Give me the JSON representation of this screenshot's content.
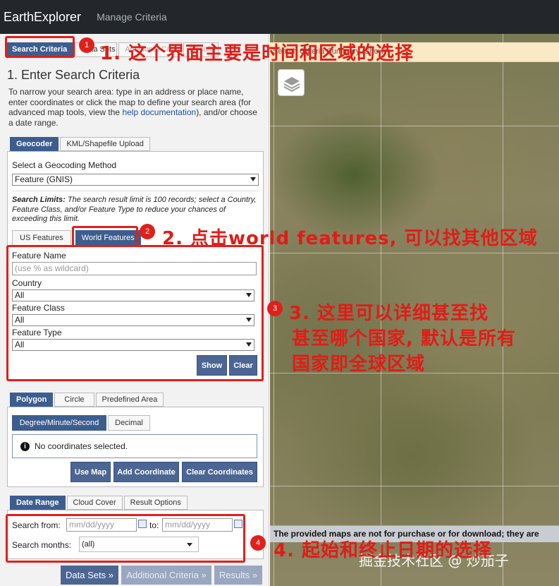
{
  "header": {
    "brand": "EarthExplorer",
    "nav_item": "Manage Criteria"
  },
  "tabs": [
    {
      "label": "Search Criteria",
      "active": true
    },
    {
      "label": "Data Sets",
      "active": false
    },
    {
      "label": "Additional Criteria",
      "active": false
    },
    {
      "label": "Results",
      "active": false
    }
  ],
  "section": {
    "title": "1. Enter Search Criteria",
    "intro_pre": "To narrow your search area: type in an address or place name, enter coordinates or click the map to define your search area (for advanced map tools, view the ",
    "intro_link": "help documentation",
    "intro_post": "), and/or choose a date range."
  },
  "geocoder": {
    "tabs": [
      "Geocoder",
      "KML/Shapefile Upload"
    ],
    "method_label": "Select a Geocoding Method",
    "method_value": "Feature (GNIS)",
    "limits_bold": "Search Limits:",
    "limits_text": " The search result limit is 100 records; select a Country, Feature Class, and/or Feature Type to reduce your chances of exceeding this limit.",
    "feature_tabs": [
      "US Features",
      "World Features"
    ],
    "feature_name_label": "Feature Name",
    "feature_name_placeholder": "(use % as wildcard)",
    "country_label": "Country",
    "country_value": "All",
    "class_label": "Feature Class",
    "class_value": "All",
    "type_label": "Feature Type",
    "type_value": "All",
    "show_button": "Show",
    "clear_button": "Clear"
  },
  "polygon": {
    "tabs": [
      "Polygon",
      "Circle",
      "Predefined Area"
    ],
    "format_options": [
      "Degree/Minute/Second",
      "Decimal"
    ],
    "no_coords": "No coordinates selected.",
    "use_map": "Use Map",
    "add_coordinate": "Add Coordinate",
    "clear_coordinates": "Clear Coordinates"
  },
  "daterange": {
    "tabs": [
      "Date Range",
      "Cloud Cover",
      "Result Options"
    ],
    "from_label": "Search from:",
    "from_placeholder": "mm/dd/yyyy",
    "to_label": "to:",
    "to_placeholder": "mm/dd/yyyy",
    "months_label": "Search months:",
    "months_value": "(all)"
  },
  "footer_buttons": [
    "Data Sets »",
    "Additional Criteria »",
    "Results »"
  ],
  "map": {
    "notice": "Search Criteria Summary (Show)",
    "disclaimer": "The provided maps are not for purchase or for download; they are"
  },
  "annotations": {
    "badges": [
      "1",
      "2",
      "3",
      "4"
    ],
    "note1": "1. 这个界面主要是时间和区域的选择",
    "note2": "2. 点击world features, 可以找其他区域",
    "note3_line1": "3. 这里可以详细甚至找",
    "note3_line2": "甚至哪个国家, 默认是所有",
    "note3_line3": "国家即全球区域",
    "note4": "4. 起始和终止日期的选择",
    "watermark": "掘金技术社区 @ 炒茄子"
  },
  "colors": {
    "accent": "#3d5d8e",
    "annotation": "#e0201b",
    "topbar": "#23272c"
  }
}
